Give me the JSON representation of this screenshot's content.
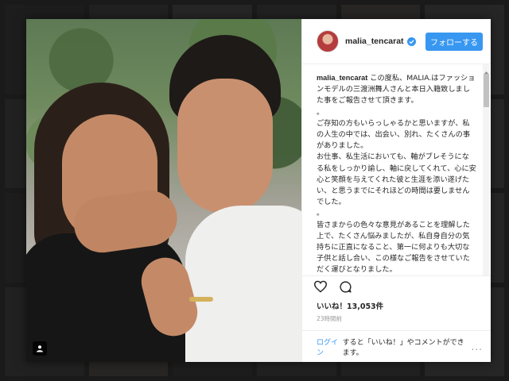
{
  "post": {
    "username": "malia_tencarat",
    "follow_label": "フォローする",
    "caption_user": "malia_tencarat",
    "caption_text": " この度私、MALIA.はファッションモデルの三渡洲舞人さんと本日入籍致しました事をご報告させて頂きます。\n。\nご存知の方もいらっしゃるかと思いますが、私の人生の中では、出会い、別れ、たくさんの事がありました。\nお仕事、私生活においても、軸がブレそうになる私をしっかり諭し、軸に戻してくれて、心に安心と笑顔を与えてくれた彼と生涯を添い遂げたい、と思うまでにそれほどの時間は要しませんでした。\n。\n皆さまからの色々な意見があることを理解した上で、たくさん悩みましたが、私自身自分の気持ちに正直になること、第一に何よりも大切な子供と話し合い、この様なご報告をさせていただく運びとなりました。\n。\n彼との出逢いに感謝をし、大切にしていきたいと思っております。",
    "likes": "いいね！13,053件",
    "time": "23時間前",
    "footer_login": "ログイン",
    "footer_rest": "すると「いいね！」やコメントができます。",
    "more": "..."
  },
  "icons": {
    "heart": "heart-icon",
    "comment": "comment-icon",
    "verified": "verified-icon",
    "tag": "user-tag-icon"
  },
  "colors": {
    "accent": "#3897f0",
    "text": "#262626",
    "muted": "#999999"
  }
}
